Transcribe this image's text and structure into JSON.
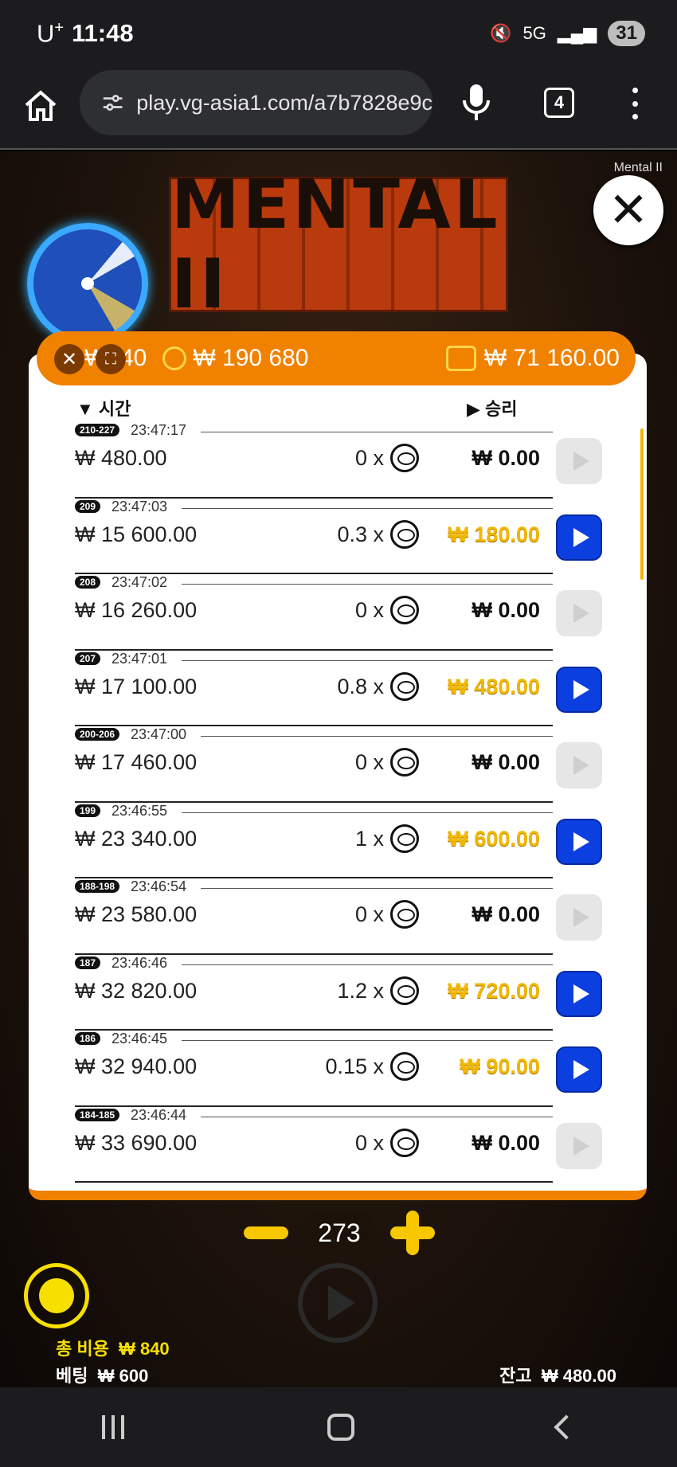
{
  "status_bar": {
    "carrier": "U",
    "carrier_sup": "+",
    "time": "11:48",
    "network": "5G",
    "battery": "31"
  },
  "browser": {
    "url": "play.vg-asia1.com/a7b7828e9c",
    "tab_count": "4"
  },
  "game": {
    "brand_label": "Mental II",
    "logo_text": "MENTAL II",
    "header": {
      "cost": "₩840",
      "coin_balance": "₩ 190 680",
      "total_win": "₩ 71 160.00"
    },
    "columns": {
      "time": "시간",
      "win": "승리"
    },
    "rows": [
      {
        "tag": "210-227",
        "time": "23:47:17",
        "bet": "₩ 480.00",
        "mult": "0 x",
        "win": "₩ 0.00",
        "gold": false
      },
      {
        "tag": "209",
        "time": "23:47:03",
        "bet": "₩ 15 600.00",
        "mult": "0.3 x",
        "win": "₩ 180.00",
        "gold": true
      },
      {
        "tag": "208",
        "time": "23:47:02",
        "bet": "₩ 16 260.00",
        "mult": "0 x",
        "win": "₩ 0.00",
        "gold": false
      },
      {
        "tag": "207",
        "time": "23:47:01",
        "bet": "₩ 17 100.00",
        "mult": "0.8 x",
        "win": "₩ 480.00",
        "gold": true
      },
      {
        "tag": "200-206",
        "time": "23:47:00",
        "bet": "₩ 17 460.00",
        "mult": "0 x",
        "win": "₩ 0.00",
        "gold": false
      },
      {
        "tag": "199",
        "time": "23:46:55",
        "bet": "₩ 23 340.00",
        "mult": "1 x",
        "win": "₩ 600.00",
        "gold": true
      },
      {
        "tag": "188-198",
        "time": "23:46:54",
        "bet": "₩ 23 580.00",
        "mult": "0 x",
        "win": "₩ 0.00",
        "gold": false
      },
      {
        "tag": "187",
        "time": "23:46:46",
        "bet": "₩ 32 820.00",
        "mult": "1.2 x",
        "win": "₩ 720.00",
        "gold": true
      },
      {
        "tag": "186",
        "time": "23:46:45",
        "bet": "₩ 32 940.00",
        "mult": "0.15 x",
        "win": "₩ 90.00",
        "gold": true
      },
      {
        "tag": "184-185",
        "time": "23:46:44",
        "bet": "₩ 33 690.00",
        "mult": "0 x",
        "win": "₩ 0.00",
        "gold": false
      }
    ],
    "stepper_value": "273",
    "total_cost_label": "총 비용",
    "total_cost_value": "₩ 840",
    "bet_label": "베팅",
    "bet_value": "₩ 600",
    "balance_label": "잔고",
    "balance_value": "₩ 480.00"
  }
}
